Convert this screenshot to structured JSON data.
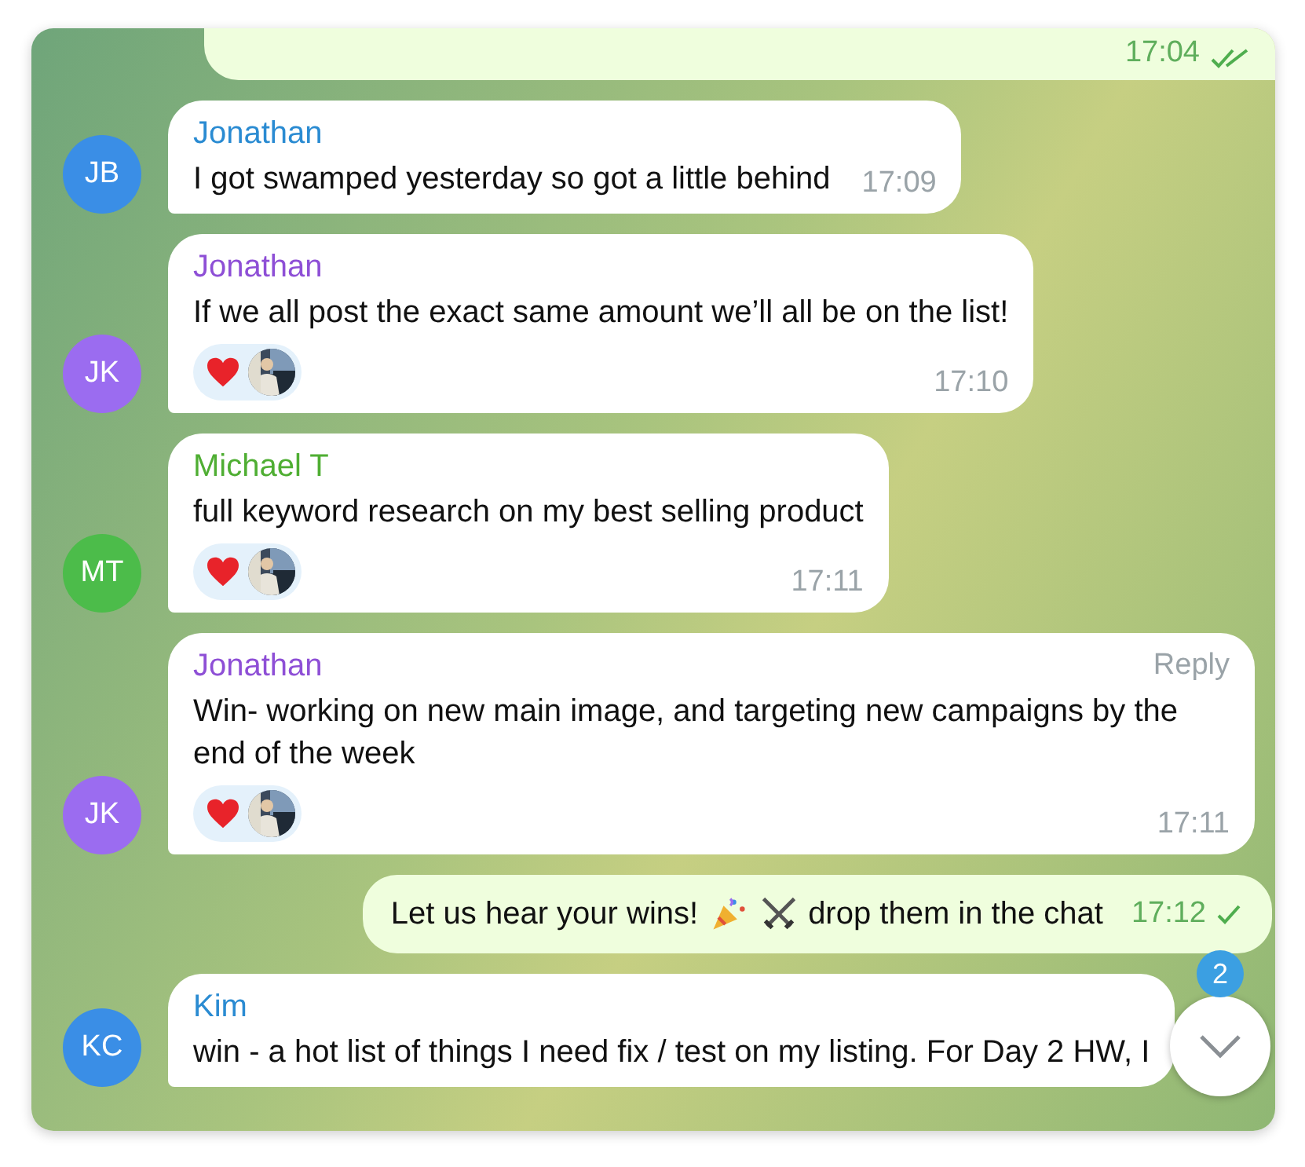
{
  "messages": [
    {
      "kind": "outgoing",
      "cut": true,
      "time": "17:04",
      "read": true
    },
    {
      "kind": "incoming",
      "avatar": {
        "initials": "JB",
        "color": "#3a8ee6"
      },
      "sender": {
        "name": "Jonathan",
        "color": "#2a8bd2"
      },
      "text": "I got swamped yesterday so got a little behind",
      "time": "17:09"
    },
    {
      "kind": "incoming",
      "avatar": {
        "initials": "JK",
        "color": "#9b6cf0"
      },
      "sender": {
        "name": "Jonathan",
        "color": "#8e4fd6"
      },
      "text": "If we all post the exact same amount we’ll all be on the list!",
      "time": "17:10",
      "reactions": [
        {
          "kind": "heart"
        },
        {
          "kind": "avatar"
        }
      ]
    },
    {
      "kind": "incoming",
      "avatar": {
        "initials": "MT",
        "color": "#4cbc4a"
      },
      "sender": {
        "name": "Michael T",
        "color": "#4fae33"
      },
      "text": "full keyword research on my best selling product",
      "time": "17:11",
      "reactions": [
        {
          "kind": "heart"
        },
        {
          "kind": "avatar"
        }
      ]
    },
    {
      "kind": "incoming",
      "avatar": {
        "initials": "JK",
        "color": "#9b6cf0"
      },
      "sender": {
        "name": "Jonathan",
        "color": "#8e4fd6"
      },
      "reply": "Reply",
      "text": "Win- working on new main image, and targeting new campaigns by the end of the week",
      "time": "17:11",
      "reactions": [
        {
          "kind": "heart"
        },
        {
          "kind": "avatar"
        }
      ]
    },
    {
      "kind": "outgoing",
      "cut": false,
      "text": "Let us hear your wins!",
      "text_after": "drop them in the chat",
      "time": "17:12",
      "read": false
    },
    {
      "kind": "incoming",
      "avatar": {
        "initials": "KC",
        "color": "#3a8ee6"
      },
      "sender": {
        "name": "Kim",
        "color": "#2a8bd2"
      },
      "text": "win - a hot list of things I need fix / test on my listing. For Day 2 HW, I"
    }
  ],
  "unread_badge": "2"
}
